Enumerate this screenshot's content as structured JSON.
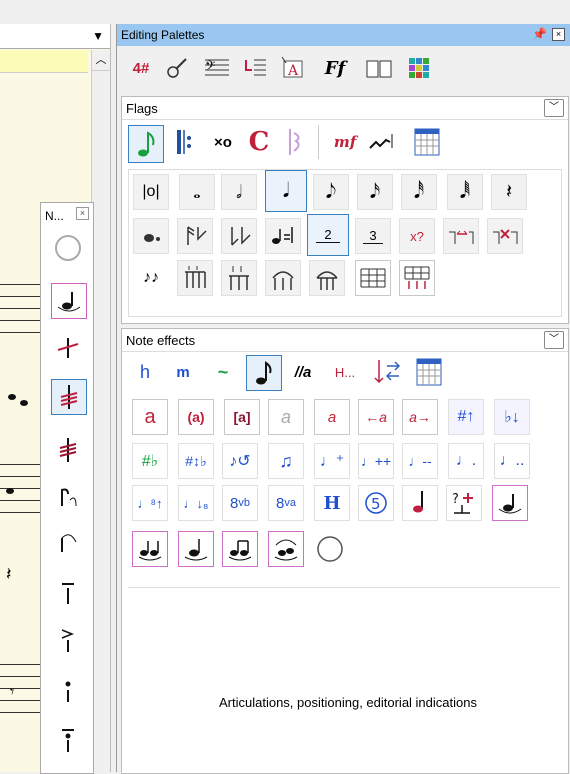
{
  "score": {
    "dropdown_icon": "chevron-down-icon",
    "scroll_up_icon": "chevron-up-icon"
  },
  "small_palette": {
    "title": "N...",
    "close_label": "×"
  },
  "editing_palettes": {
    "title": "Editing Palettes",
    "pin_icon": "pin-icon",
    "close_label": "×",
    "toolbar": [
      "4#",
      "guitar",
      "bass-clef-staff",
      "note-list",
      "lyrics-A",
      "dynamics-Ff",
      "book",
      "grid"
    ],
    "flags": {
      "title": "Flags",
      "strip": [
        "note",
        "barline",
        "×o",
        "C",
        "harmonic-clef",
        "mf",
        "slur",
        "grid"
      ],
      "row1": [
        "double-whole",
        "whole",
        "half",
        "quarter",
        "eighth",
        "sixteenth",
        "thirty-second",
        "sixty-fourth",
        "rest"
      ],
      "row2": [
        "dotted",
        "flag-up",
        "flag-down",
        "equals",
        "2",
        "3",
        "x?",
        "arrow-left-right",
        "x-right"
      ],
      "row3": [
        "beamed-pair",
        "beam-up-arrows",
        "beam-down-arrows",
        "arch",
        "arch-multi",
        "table",
        "table-red"
      ],
      "tuplet_2": "2",
      "tuplet_3": "3",
      "x_question": "x?"
    },
    "note_effects": {
      "title": "Note effects",
      "strip_labels": [
        "h",
        "m",
        "~",
        "note",
        "//a",
        "H...",
        "arrows",
        "grid"
      ],
      "row1": [
        "a",
        "(a)",
        "[a]",
        "a",
        "a",
        "←a",
        "a→",
        "#↑",
        "♭↓"
      ],
      "row2": [
        "#♭",
        "#↕♭",
        "repeat-note",
        "beamed",
        "accent-up",
        "♪++",
        "♪--",
        "dot",
        "double-dot"
      ],
      "row3": [
        "8↑",
        "8↓",
        "8vb",
        "8va",
        "H",
        "5",
        "note-red",
        "?+",
        "pink-note"
      ],
      "row4": [
        "eye-note-1",
        "eye-note-2",
        "eye-note-3",
        "eye-note-4",
        "compass"
      ],
      "description": "Articulations, positioning, editorial indications"
    }
  }
}
